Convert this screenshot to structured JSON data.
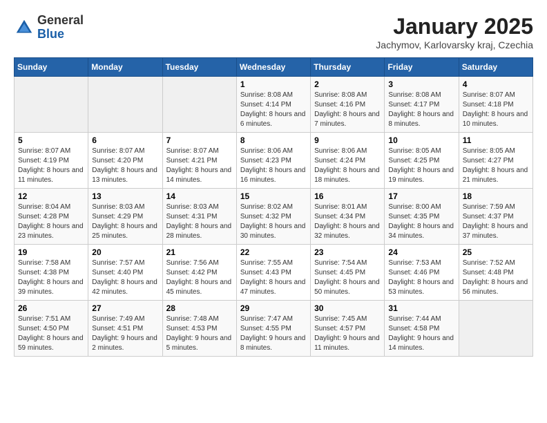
{
  "logo": {
    "general": "General",
    "blue": "Blue"
  },
  "calendar": {
    "title": "January 2025",
    "subtitle": "Jachymov, Karlovarsky kraj, Czechia",
    "days_of_week": [
      "Sunday",
      "Monday",
      "Tuesday",
      "Wednesday",
      "Thursday",
      "Friday",
      "Saturday"
    ],
    "weeks": [
      [
        {
          "day": "",
          "content": ""
        },
        {
          "day": "",
          "content": ""
        },
        {
          "day": "",
          "content": ""
        },
        {
          "day": "1",
          "content": "Sunrise: 8:08 AM\nSunset: 4:14 PM\nDaylight: 8 hours and 6 minutes."
        },
        {
          "day": "2",
          "content": "Sunrise: 8:08 AM\nSunset: 4:16 PM\nDaylight: 8 hours and 7 minutes."
        },
        {
          "day": "3",
          "content": "Sunrise: 8:08 AM\nSunset: 4:17 PM\nDaylight: 8 hours and 8 minutes."
        },
        {
          "day": "4",
          "content": "Sunrise: 8:07 AM\nSunset: 4:18 PM\nDaylight: 8 hours and 10 minutes."
        }
      ],
      [
        {
          "day": "5",
          "content": "Sunrise: 8:07 AM\nSunset: 4:19 PM\nDaylight: 8 hours and 11 minutes."
        },
        {
          "day": "6",
          "content": "Sunrise: 8:07 AM\nSunset: 4:20 PM\nDaylight: 8 hours and 13 minutes."
        },
        {
          "day": "7",
          "content": "Sunrise: 8:07 AM\nSunset: 4:21 PM\nDaylight: 8 hours and 14 minutes."
        },
        {
          "day": "8",
          "content": "Sunrise: 8:06 AM\nSunset: 4:23 PM\nDaylight: 8 hours and 16 minutes."
        },
        {
          "day": "9",
          "content": "Sunrise: 8:06 AM\nSunset: 4:24 PM\nDaylight: 8 hours and 18 minutes."
        },
        {
          "day": "10",
          "content": "Sunrise: 8:05 AM\nSunset: 4:25 PM\nDaylight: 8 hours and 19 minutes."
        },
        {
          "day": "11",
          "content": "Sunrise: 8:05 AM\nSunset: 4:27 PM\nDaylight: 8 hours and 21 minutes."
        }
      ],
      [
        {
          "day": "12",
          "content": "Sunrise: 8:04 AM\nSunset: 4:28 PM\nDaylight: 8 hours and 23 minutes."
        },
        {
          "day": "13",
          "content": "Sunrise: 8:03 AM\nSunset: 4:29 PM\nDaylight: 8 hours and 25 minutes."
        },
        {
          "day": "14",
          "content": "Sunrise: 8:03 AM\nSunset: 4:31 PM\nDaylight: 8 hours and 28 minutes."
        },
        {
          "day": "15",
          "content": "Sunrise: 8:02 AM\nSunset: 4:32 PM\nDaylight: 8 hours and 30 minutes."
        },
        {
          "day": "16",
          "content": "Sunrise: 8:01 AM\nSunset: 4:34 PM\nDaylight: 8 hours and 32 minutes."
        },
        {
          "day": "17",
          "content": "Sunrise: 8:00 AM\nSunset: 4:35 PM\nDaylight: 8 hours and 34 minutes."
        },
        {
          "day": "18",
          "content": "Sunrise: 7:59 AM\nSunset: 4:37 PM\nDaylight: 8 hours and 37 minutes."
        }
      ],
      [
        {
          "day": "19",
          "content": "Sunrise: 7:58 AM\nSunset: 4:38 PM\nDaylight: 8 hours and 39 minutes."
        },
        {
          "day": "20",
          "content": "Sunrise: 7:57 AM\nSunset: 4:40 PM\nDaylight: 8 hours and 42 minutes."
        },
        {
          "day": "21",
          "content": "Sunrise: 7:56 AM\nSunset: 4:42 PM\nDaylight: 8 hours and 45 minutes."
        },
        {
          "day": "22",
          "content": "Sunrise: 7:55 AM\nSunset: 4:43 PM\nDaylight: 8 hours and 47 minutes."
        },
        {
          "day": "23",
          "content": "Sunrise: 7:54 AM\nSunset: 4:45 PM\nDaylight: 8 hours and 50 minutes."
        },
        {
          "day": "24",
          "content": "Sunrise: 7:53 AM\nSunset: 4:46 PM\nDaylight: 8 hours and 53 minutes."
        },
        {
          "day": "25",
          "content": "Sunrise: 7:52 AM\nSunset: 4:48 PM\nDaylight: 8 hours and 56 minutes."
        }
      ],
      [
        {
          "day": "26",
          "content": "Sunrise: 7:51 AM\nSunset: 4:50 PM\nDaylight: 8 hours and 59 minutes."
        },
        {
          "day": "27",
          "content": "Sunrise: 7:49 AM\nSunset: 4:51 PM\nDaylight: 9 hours and 2 minutes."
        },
        {
          "day": "28",
          "content": "Sunrise: 7:48 AM\nSunset: 4:53 PM\nDaylight: 9 hours and 5 minutes."
        },
        {
          "day": "29",
          "content": "Sunrise: 7:47 AM\nSunset: 4:55 PM\nDaylight: 9 hours and 8 minutes."
        },
        {
          "day": "30",
          "content": "Sunrise: 7:45 AM\nSunset: 4:57 PM\nDaylight: 9 hours and 11 minutes."
        },
        {
          "day": "31",
          "content": "Sunrise: 7:44 AM\nSunset: 4:58 PM\nDaylight: 9 hours and 14 minutes."
        },
        {
          "day": "",
          "content": ""
        }
      ]
    ]
  }
}
